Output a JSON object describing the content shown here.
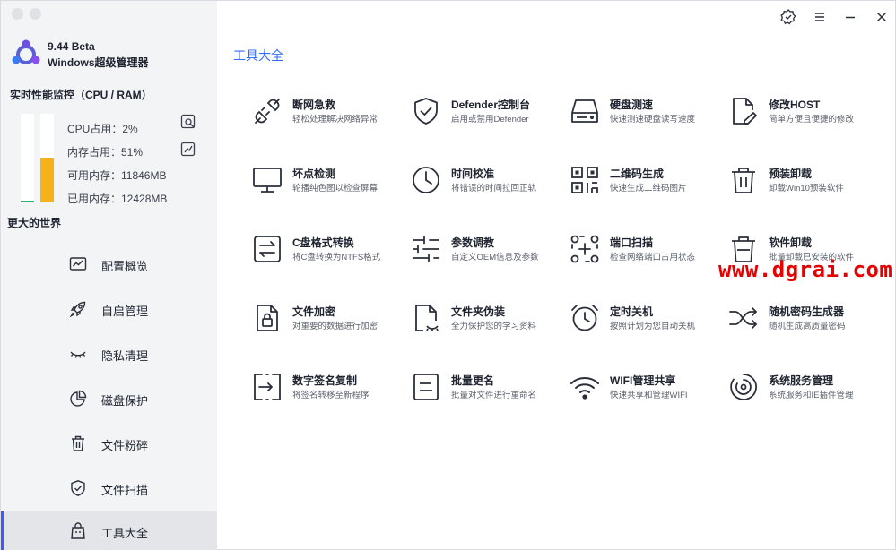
{
  "app": {
    "version": "9.44 Beta",
    "name": "Windows超级管理器"
  },
  "monitor": {
    "title": "实时性能监控（CPU / RAM）",
    "cpu": "CPU占用：2%",
    "mem": "内存占用：51%",
    "avail": "可用内存：11846MB",
    "used": "已用内存：12428MB",
    "cpu_fraction": 0.02,
    "mem_fraction": 0.51,
    "cpu_color": "#22b573",
    "mem_color": "#f5b21a"
  },
  "tagline": "更大的世界",
  "nav": [
    {
      "label": "配置概览",
      "icon": "chart-icon"
    },
    {
      "label": "自启管理",
      "icon": "rocket-icon"
    },
    {
      "label": "隐私清理",
      "icon": "eye-closed-icon"
    },
    {
      "label": "磁盘保护",
      "icon": "pie-icon"
    },
    {
      "label": "文件粉碎",
      "icon": "trash-icon"
    },
    {
      "label": "文件扫描",
      "icon": "shield-icon"
    },
    {
      "label": "工具大全",
      "icon": "bag-icon"
    }
  ],
  "section_title": "工具大全",
  "tools": [
    {
      "name": "断网急救",
      "desc": "轻松处理解决网络异常",
      "icon": "plug-icon"
    },
    {
      "name": "Defender控制台",
      "desc": "启用或禁用Defender",
      "icon": "shield-check-icon"
    },
    {
      "name": "硬盘测速",
      "desc": "快速测速硬盘读写速度",
      "icon": "disk-icon"
    },
    {
      "name": "修改HOST",
      "desc": "简单方便且便捷的修改",
      "icon": "file-edit-icon"
    },
    {
      "name": "坏点检测",
      "desc": "轮播纯色图以检查屏幕",
      "icon": "monitor-icon"
    },
    {
      "name": "时间校准",
      "desc": "将错误的时间拉回正轨",
      "icon": "clock-icon"
    },
    {
      "name": "二维码生成",
      "desc": "快速生成二维码图片",
      "icon": "qr-icon"
    },
    {
      "name": "预装卸载",
      "desc": "卸载Win10预装软件",
      "icon": "trash-icon"
    },
    {
      "name": "C盘格式转换",
      "desc": "将C盘转换为NTFS格式",
      "icon": "swap-icon"
    },
    {
      "name": "参数调教",
      "desc": "自定义OEM信息及参数",
      "icon": "sliders-icon"
    },
    {
      "name": "端口扫描",
      "desc": "检查网络端口占用状态",
      "icon": "scan-icon"
    },
    {
      "name": "软件卸载",
      "desc": "批量卸载已安装的软件",
      "icon": "trash-icon"
    },
    {
      "name": "文件加密",
      "desc": "对重要的数据进行加密",
      "icon": "file-lock-icon"
    },
    {
      "name": "文件夹伪装",
      "desc": "全力保护您的学习资料",
      "icon": "file-mask-icon"
    },
    {
      "name": "定时关机",
      "desc": "按照计划为您自动关机",
      "icon": "alarm-icon"
    },
    {
      "name": "随机密码生成器",
      "desc": "随机生成高质量密码",
      "icon": "shuffle-icon"
    },
    {
      "name": "数字签名复制",
      "desc": "将签名转移至新程序",
      "icon": "sign-copy-icon"
    },
    {
      "name": "批量更名",
      "desc": "批量对文件进行重命名",
      "icon": "rename-icon"
    },
    {
      "name": "WIFI管理共享",
      "desc": "快速共享和管理WIFI",
      "icon": "wifi-icon"
    },
    {
      "name": "系统服务管理",
      "desc": "系统服务和IE插件管理",
      "icon": "service-icon"
    }
  ],
  "watermark": "www.dgrai.com",
  "colors": {
    "accent": "#2f6bff",
    "sidebar_bg": "#f3f4f6",
    "active_bar": "#3d5afe"
  }
}
